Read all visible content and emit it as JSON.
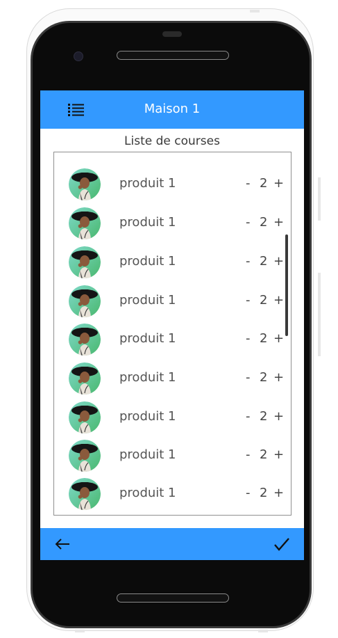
{
  "header": {
    "title": "Maison 1",
    "menu_icon": "list-icon"
  },
  "list": {
    "title": "Liste de courses",
    "items": [
      {
        "name": "produit 1",
        "minus": "-",
        "quantity": "2",
        "plus": "+"
      },
      {
        "name": "produit 1",
        "minus": "-",
        "quantity": "2",
        "plus": "+"
      },
      {
        "name": "produit 1",
        "minus": "-",
        "quantity": "2",
        "plus": "+"
      },
      {
        "name": "produit 1",
        "minus": "-",
        "quantity": "2",
        "plus": "+"
      },
      {
        "name": "produit 1",
        "minus": "-",
        "quantity": "2",
        "plus": "+"
      },
      {
        "name": "produit 1",
        "minus": "-",
        "quantity": "2",
        "plus": "+"
      },
      {
        "name": "produit 1",
        "minus": "-",
        "quantity": "2",
        "plus": "+"
      },
      {
        "name": "produit 1",
        "minus": "-",
        "quantity": "2",
        "plus": "+"
      },
      {
        "name": "produit 1",
        "minus": "-",
        "quantity": "2",
        "plus": "+"
      }
    ]
  },
  "footer": {
    "back_icon": "arrow-left-icon",
    "confirm_icon": "check-icon"
  },
  "colors": {
    "accent": "#3399ff",
    "device": "#0b0b0b",
    "text": "#555555"
  }
}
